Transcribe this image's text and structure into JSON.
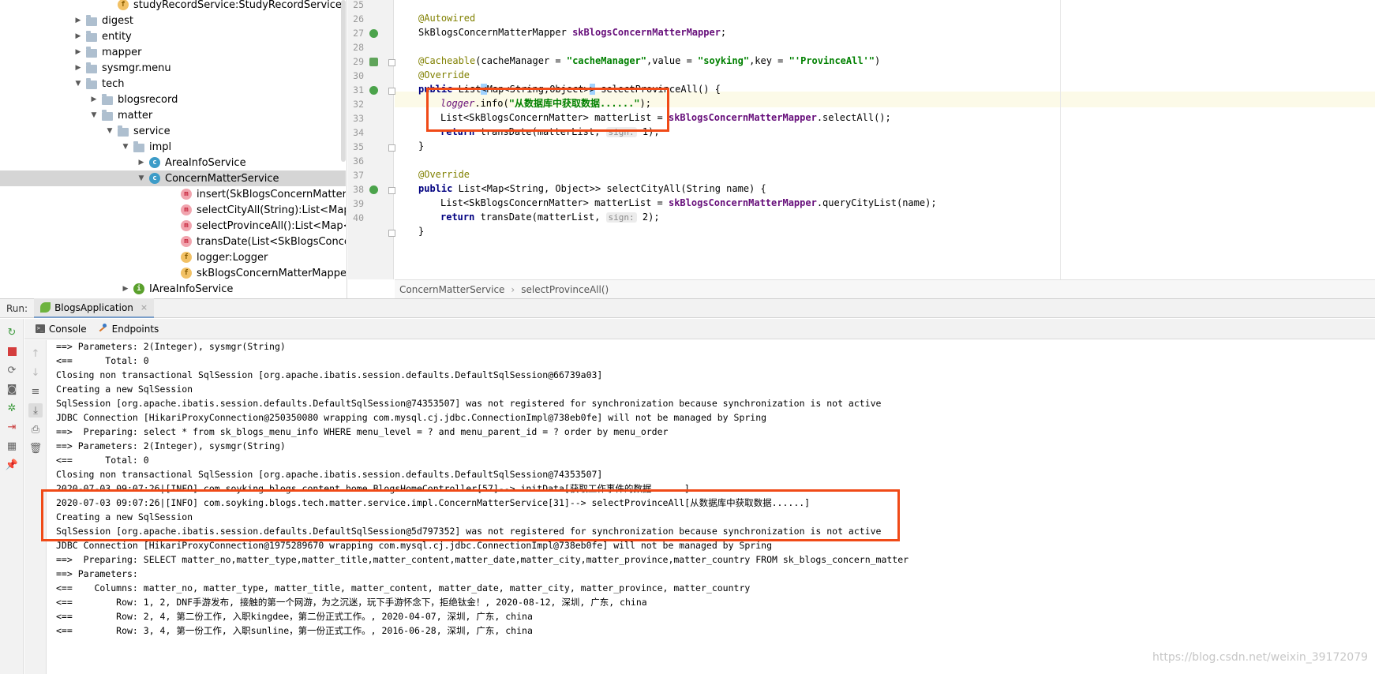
{
  "tree": {
    "items": [
      {
        "label": "studyRecordService:StudyRecordService",
        "icon": "field-icon",
        "kind": "f",
        "expand": "none"
      },
      {
        "label": "digest",
        "icon": "folder-icon",
        "kind": "folder",
        "expand": "closed"
      },
      {
        "label": "entity",
        "icon": "folder-icon",
        "kind": "folder",
        "expand": "closed"
      },
      {
        "label": "mapper",
        "icon": "folder-icon",
        "kind": "folder",
        "expand": "closed"
      },
      {
        "label": "sysmgr.menu",
        "icon": "folder-icon",
        "kind": "folder",
        "expand": "closed"
      },
      {
        "label": "tech",
        "icon": "folder-icon",
        "kind": "folder",
        "expand": "open"
      },
      {
        "label": "blogsrecord",
        "icon": "folder-icon",
        "kind": "folder",
        "expand": "closed"
      },
      {
        "label": "matter",
        "icon": "folder-icon",
        "kind": "folder",
        "expand": "open"
      },
      {
        "label": "service",
        "icon": "folder-icon",
        "kind": "folder",
        "expand": "open"
      },
      {
        "label": "impl",
        "icon": "folder-icon",
        "kind": "folder",
        "expand": "open"
      },
      {
        "label": "AreaInfoService",
        "icon": "class-icon",
        "kind": "c",
        "expand": "closed"
      },
      {
        "label": "ConcernMatterService",
        "icon": "class-icon",
        "kind": "c",
        "expand": "open"
      },
      {
        "label": "insert(SkBlogsConcernMatter):int",
        "icon": "method-icon",
        "kind": "m",
        "expand": "none"
      },
      {
        "label": "selectCityAll(String):List<Map<String, Object>>",
        "icon": "method-icon",
        "kind": "m",
        "expand": "none"
      },
      {
        "label": "selectProvinceAll():List<Map<String, Object>>",
        "icon": "method-icon",
        "kind": "m",
        "expand": "none"
      },
      {
        "label": "transDate(List<SkBlogsConcernMatter>, int)",
        "icon": "method-icon",
        "kind": "m",
        "expand": "none"
      },
      {
        "label": "logger:Logger",
        "icon": "field-icon",
        "kind": "f",
        "expand": "none"
      },
      {
        "label": "skBlogsConcernMatterMapper:SkBlogsConcernMatterMapper",
        "icon": "field-icon",
        "kind": "f",
        "expand": "none"
      },
      {
        "label": "IAreaInfoService",
        "icon": "interface-icon",
        "kind": "i",
        "expand": "closed"
      }
    ]
  },
  "editor": {
    "line_numbers": [
      "25",
      "26",
      "27",
      "28",
      "29",
      "30",
      "31",
      "32",
      "33",
      "34",
      "35",
      "36",
      "37",
      "38",
      "39",
      "40"
    ],
    "code": {
      "l25_ann": "@Autowired",
      "l26_type": "SkBlogsConcernMatterMapper ",
      "l26_field": "skBlogsConcernMatterMapper",
      "l26_end": ";",
      "l28_ann": "@Cacheable",
      "l28_a": "(cacheManager = ",
      "l28_s1": "\"cacheManager\"",
      "l28_b": ",value = ",
      "l28_s2": "\"soyking\"",
      "l28_c": ",key = ",
      "l28_s3": "\"'ProvinceAll'\"",
      "l28_d": ")",
      "l29_ann": "@Override",
      "l30_kw": "public",
      "l30_a": " List",
      "l30_lt": "<",
      "l30_b": "Map<String,Object>",
      "l30_gt": ">",
      "l30_c": " selectProvinceAll() {",
      "l31_field": "logger",
      "l31_a": ".info(",
      "l31_str": "\"从数据库中获取数据......\"",
      "l31_b": ");",
      "l32_a": "List<SkBlogsConcernMatter> matterList = ",
      "l32_field": "skBlogsConcernMatterMapper",
      "l32_b": ".selectAll();",
      "l33_kw": "return",
      "l33_a": " transDate(matterList, ",
      "l33_hint": "sign:",
      "l33_b": " 1);",
      "l34": "}",
      "l36_ann": "@Override",
      "l37_kw": "public",
      "l37_a": " List<Map<String, Object>> selectCityAll(String name) {",
      "l38_a": "List<SkBlogsConcernMatter> matterList = ",
      "l38_field": "skBlogsConcernMatterMapper",
      "l38_b": ".queryCityList(name);",
      "l39_kw": "return",
      "l39_a": " transDate(matterList, ",
      "l39_hint": "sign:",
      "l39_b": " 2);",
      "l40": "}"
    }
  },
  "breadcrumb": [
    "ConcernMatterService",
    "selectProvinceAll()"
  ],
  "run": {
    "label": "Run:",
    "tab": "BlogsApplication",
    "close": "×",
    "console_tab": "Console",
    "endpoints_tab": "Endpoints"
  },
  "console": {
    "lines": [
      "==> Parameters: 2(Integer), sysmgr(String)",
      "<==      Total: 0",
      "Closing non transactional SqlSession [org.apache.ibatis.session.defaults.DefaultSqlSession@66739a03]",
      "Creating a new SqlSession",
      "SqlSession [org.apache.ibatis.session.defaults.DefaultSqlSession@74353507] was not registered for synchronization because synchronization is not active",
      "JDBC Connection [HikariProxyConnection@250350080 wrapping com.mysql.cj.jdbc.ConnectionImpl@738eb0fe] will not be managed by Spring",
      "==>  Preparing: select * from sk_blogs_menu_info WHERE menu_level = ? and menu_parent_id = ? order by menu_order",
      "==> Parameters: 2(Integer), sysmgr(String)",
      "<==      Total: 0",
      "Closing non transactional SqlSession [org.apache.ibatis.session.defaults.DefaultSqlSession@74353507]",
      "2020-07-03 09:07:26|[INFO] com.soyking.blogs.content.home.BlogsHomeController[57]--> initData[获取工作事件的数据......]",
      "2020-07-03 09:07:26|[INFO] com.soyking.blogs.tech.matter.service.impl.ConcernMatterService[31]--> selectProvinceAll[从数据库中获取数据......]",
      "Creating a new SqlSession",
      "SqlSession [org.apache.ibatis.session.defaults.DefaultSqlSession@5d797352] was not registered for synchronization because synchronization is not active",
      "JDBC Connection [HikariProxyConnection@1975289670 wrapping com.mysql.cj.jdbc.ConnectionImpl@738eb0fe] will not be managed by Spring",
      "==>  Preparing: SELECT matter_no,matter_type,matter_title,matter_content,matter_date,matter_city,matter_province,matter_country FROM sk_blogs_concern_matter",
      "==> Parameters: ",
      "<==    Columns: matter_no, matter_type, matter_title, matter_content, matter_date, matter_city, matter_province, matter_country",
      "<==        Row: 1, 2, DNF手游发布, 接触的第一个网游，为之沉迷，玩下手游怀念下，拒绝钛金！, 2020-08-12, 深圳, 广东, china",
      "<==        Row: 2, 4, 第二份工作, 入职kingdee，第二份正式工作。, 2020-04-07, 深圳, 广东, china",
      "<==        Row: 3, 4, 第一份工作, 入职sunline，第一份正式工作。, 2016-06-28, 深圳, 广东, china"
    ]
  },
  "watermark": "https://blog.csdn.net/weixin_39172079",
  "colors": {
    "annotation_box": "#f04a17",
    "caret_row": "#fcfae8",
    "selected_row": "#d5d5d5"
  }
}
